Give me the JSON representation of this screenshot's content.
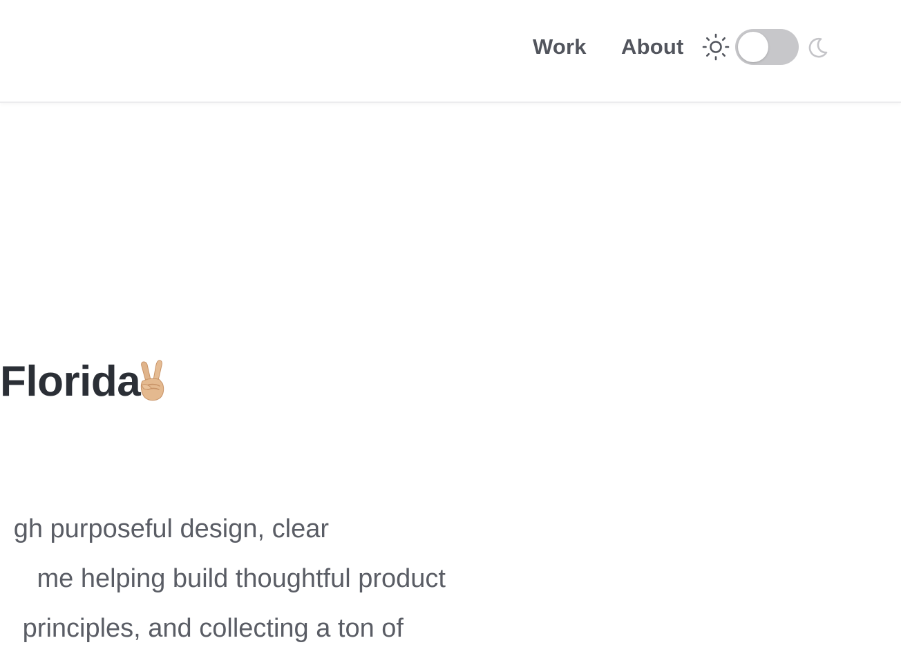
{
  "nav": {
    "work_label": "Work",
    "about_label": "About"
  },
  "theme_toggle": {
    "state": "light",
    "light_icon": "sun-icon",
    "dark_icon": "moon-icon"
  },
  "hero": {
    "headline": "Florida.",
    "emoji": "victory-hand-emoji"
  },
  "intro": {
    "line1": "gh purposeful design, clear",
    "line2": "me helping build thoughtful product",
    "line3": "principles, and collecting a ton of"
  },
  "colors": {
    "nav_text": "#52555d",
    "headline_text": "#2b2f36",
    "body_text": "#5a5d65",
    "toggle_track": "#c7c7ca"
  }
}
